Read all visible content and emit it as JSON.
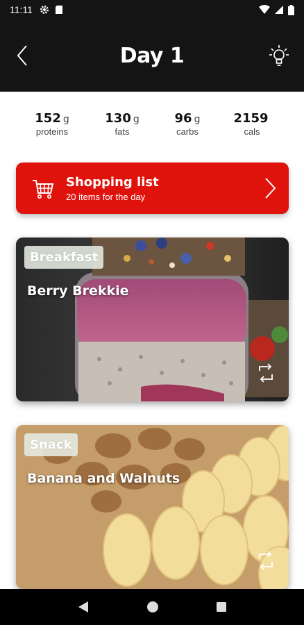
{
  "status": {
    "time": "11:11"
  },
  "header": {
    "title": "Day 1",
    "back_icon": "chevron-left-icon",
    "tip_icon": "lightbulb-icon"
  },
  "macros": [
    {
      "value": "152",
      "unit": "g",
      "label": "proteins"
    },
    {
      "value": "130",
      "unit": "g",
      "label": "fats"
    },
    {
      "value": "96",
      "unit": "g",
      "label": "carbs"
    },
    {
      "value": "2159",
      "unit": "",
      "label": "cals"
    }
  ],
  "shopping": {
    "title": "Shopping list",
    "subtitle": "20 items for the day",
    "color": "#e0120c"
  },
  "meals": [
    {
      "type": "Breakfast",
      "name": "Berry Brekkie"
    },
    {
      "type": "Snack",
      "name": "Banana and Walnuts"
    }
  ]
}
